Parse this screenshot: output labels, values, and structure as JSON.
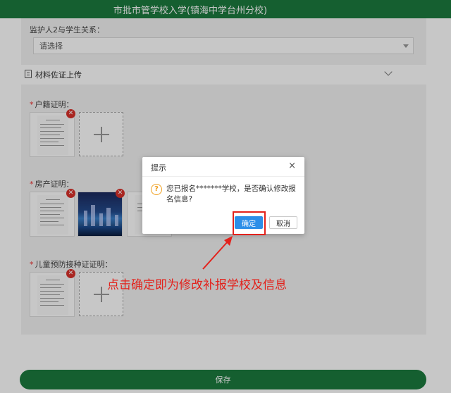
{
  "header": {
    "title": "市批市管学校入学(镇海中学台州分校)"
  },
  "guardian": {
    "label": "监护人2与学生关系：",
    "select_value": "请选择"
  },
  "section": {
    "title": "材料佐证上传"
  },
  "uploads": [
    {
      "label": "户籍证明："
    },
    {
      "label": "房产证明："
    },
    {
      "label": "儿童预防接种证证明："
    }
  ],
  "icons": {
    "delete": "close-icon",
    "add": "plus-icon",
    "collapse": "chevron-down-icon",
    "document": "document-icon"
  },
  "dialog": {
    "title": "提示",
    "close": "×",
    "question_glyph": "?",
    "message": "您已报名*******学校，是否确认修改报名信息?",
    "ok_label": "确定",
    "cancel_label": "取消"
  },
  "annotation": {
    "text": "点击确定即为修改补报学校及信息"
  },
  "save": {
    "label": "保存"
  },
  "colors": {
    "brand_green": "#1b7a3e",
    "primary_blue": "#2c8ee8",
    "annotation_red": "#e3221c"
  }
}
